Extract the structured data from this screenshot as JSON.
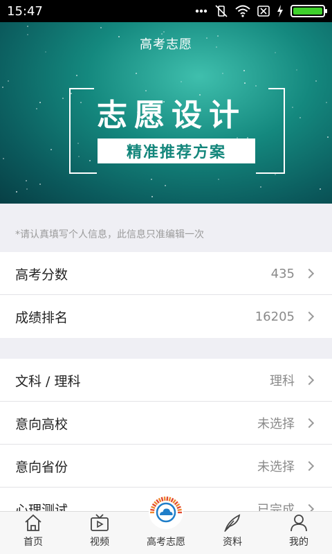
{
  "status_bar": {
    "time": "15:47",
    "battery_level": 1.0,
    "battery_color": "#3fd12c"
  },
  "banner": {
    "header_title": "高考志愿",
    "big_title": "志愿设计",
    "subtitle": "精准推荐方案",
    "accent_color": "#13867b"
  },
  "notice": "*请认真填写个人信息，此信息只准编辑一次",
  "score_section": {
    "items": [
      {
        "label": "高考分数",
        "value": "435"
      },
      {
        "label": "成绩排名",
        "value": "16205"
      }
    ]
  },
  "pref_section": {
    "items": [
      {
        "label": "文科 / 理科",
        "value": "理科"
      },
      {
        "label": "意向高校",
        "value": "未选择"
      },
      {
        "label": "意向省份",
        "value": "未选择"
      },
      {
        "label": "心理测试",
        "value": "已完成"
      }
    ]
  },
  "tabbar": {
    "tabs": [
      {
        "label": "首页",
        "icon": "home-icon"
      },
      {
        "label": "视频",
        "icon": "video-icon"
      },
      {
        "label": "高考志愿",
        "icon": "sun-cloud-icon"
      },
      {
        "label": "资料",
        "icon": "feather-icon"
      },
      {
        "label": "我的",
        "icon": "person-icon"
      }
    ]
  }
}
